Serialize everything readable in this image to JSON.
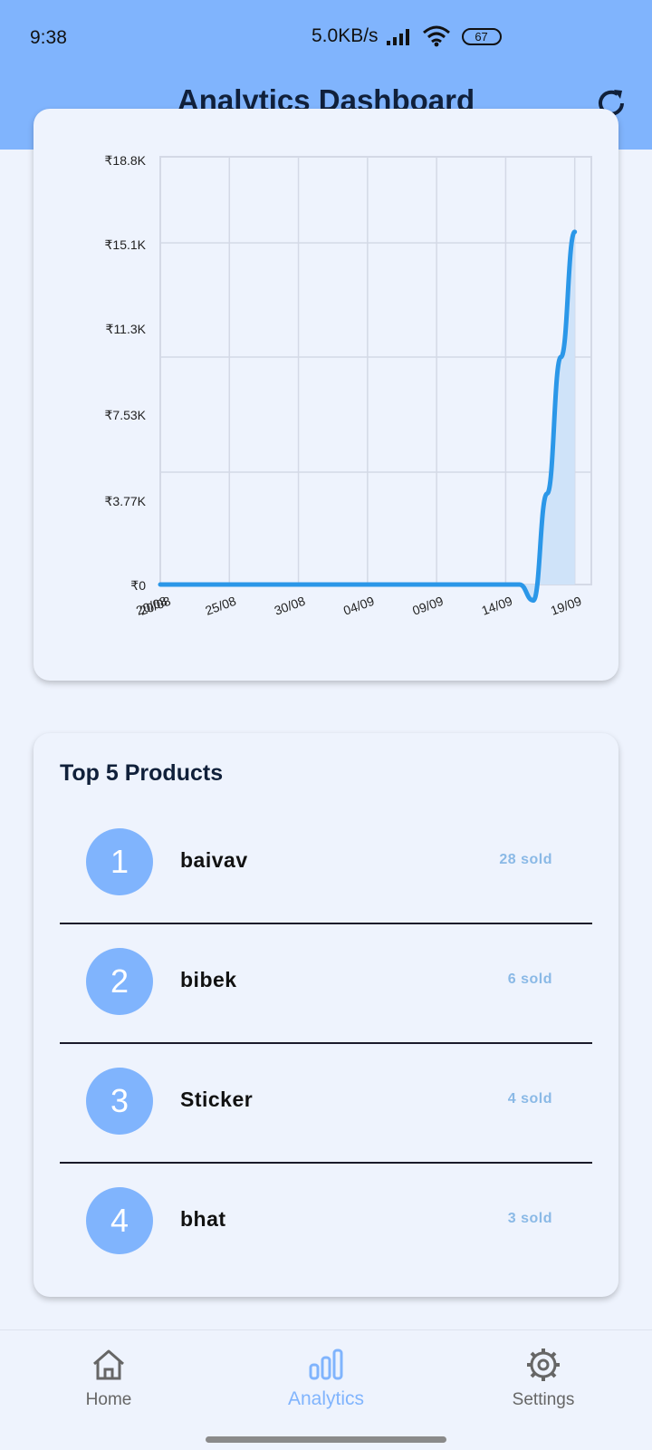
{
  "status_bar": {
    "time": "9:38",
    "speed": "5.0KB/s",
    "battery": "67"
  },
  "header": {
    "title": "Analytics Dashboard",
    "refresh_icon": "refresh-icon"
  },
  "colors": {
    "accent": "#80b4fd",
    "line": "#2b97e8",
    "fill": "#cfe3f9"
  },
  "chart_data": {
    "type": "line",
    "x": [
      "20/08",
      "25/08",
      "30/08",
      "04/09",
      "09/09",
      "14/09",
      "19/09"
    ],
    "xlabel": "",
    "ylabel": "",
    "y_ticks": [
      "₹0",
      "₹3.77K",
      "₹7.53K",
      "₹11.3K",
      "₹15.1K",
      "₹18.8K"
    ],
    "ylim": [
      0,
      18800
    ],
    "x_extra_tick": "20/08",
    "series": [
      {
        "dates": [
          "20/08",
          "14/09",
          "15/09",
          "16/09",
          "17/09",
          "18/09",
          "19/09"
        ],
        "values": [
          0,
          0,
          0,
          -700,
          4000,
          10000,
          15500
        ]
      }
    ],
    "grid": true
  },
  "products": {
    "title": "Top 5 Products",
    "items": [
      {
        "rank": "1",
        "name": "baivav",
        "sold": "28 sold"
      },
      {
        "rank": "2",
        "name": "bibek",
        "sold": "6 sold"
      },
      {
        "rank": "3",
        "name": "Sticker",
        "sold": "4 sold"
      },
      {
        "rank": "4",
        "name": "bhat",
        "sold": "3 sold"
      }
    ]
  },
  "nav": {
    "items": [
      {
        "label": "Home",
        "icon": "home-icon"
      },
      {
        "label": "Analytics",
        "icon": "analytics-icon"
      },
      {
        "label": "Settings",
        "icon": "settings-icon"
      }
    ]
  }
}
